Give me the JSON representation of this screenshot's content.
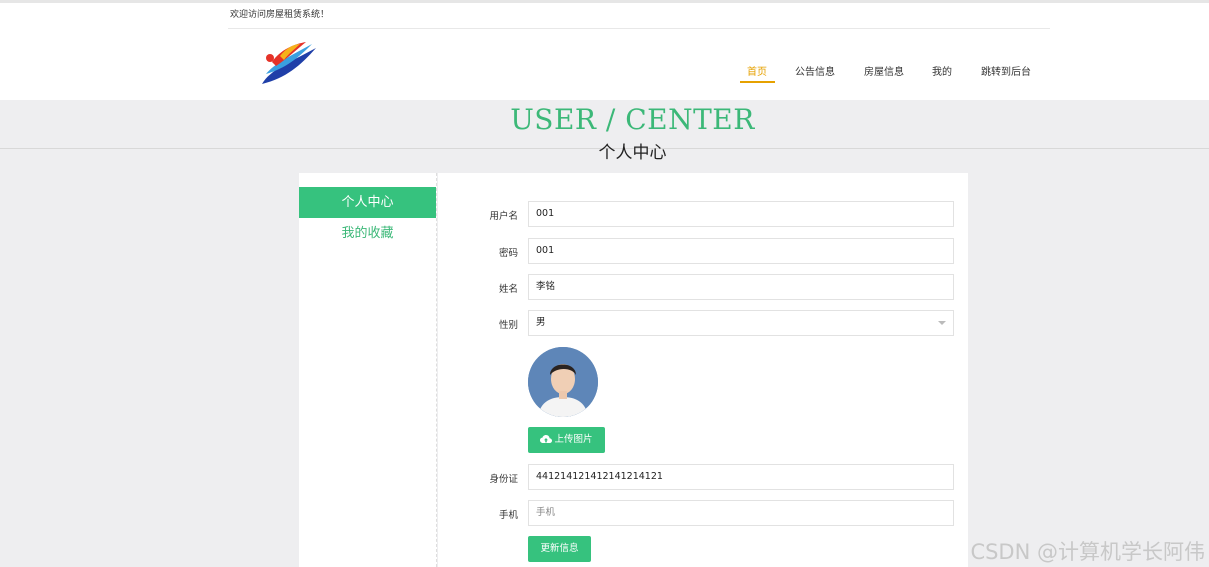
{
  "header": {
    "welcome": "欢迎访问房屋租赁系统！",
    "nav": [
      "首页",
      "公告信息",
      "房屋信息",
      "我的",
      "跳转到后台"
    ],
    "active_nav": "首页"
  },
  "banner": {
    "title_en": "USER / CENTER",
    "title_cn": "个人中心"
  },
  "sidebar": {
    "items": [
      "个人中心",
      "我的收藏"
    ]
  },
  "form": {
    "username_label": "用户名",
    "username_value": "001",
    "password_label": "密码",
    "password_value": "001",
    "name_label": "姓名",
    "name_value": "李铭",
    "gender_label": "性别",
    "gender_value": "男",
    "upload_label": "上传图片",
    "id_label": "身份证",
    "id_value": "441214121412141214121",
    "phone_label": "手机",
    "phone_placeholder": "手机",
    "update_label": "更新信息"
  },
  "watermark": "CSDN @计算机学长阿伟",
  "colors": {
    "accent_green": "#36c27e",
    "nav_active": "#e6a100"
  }
}
